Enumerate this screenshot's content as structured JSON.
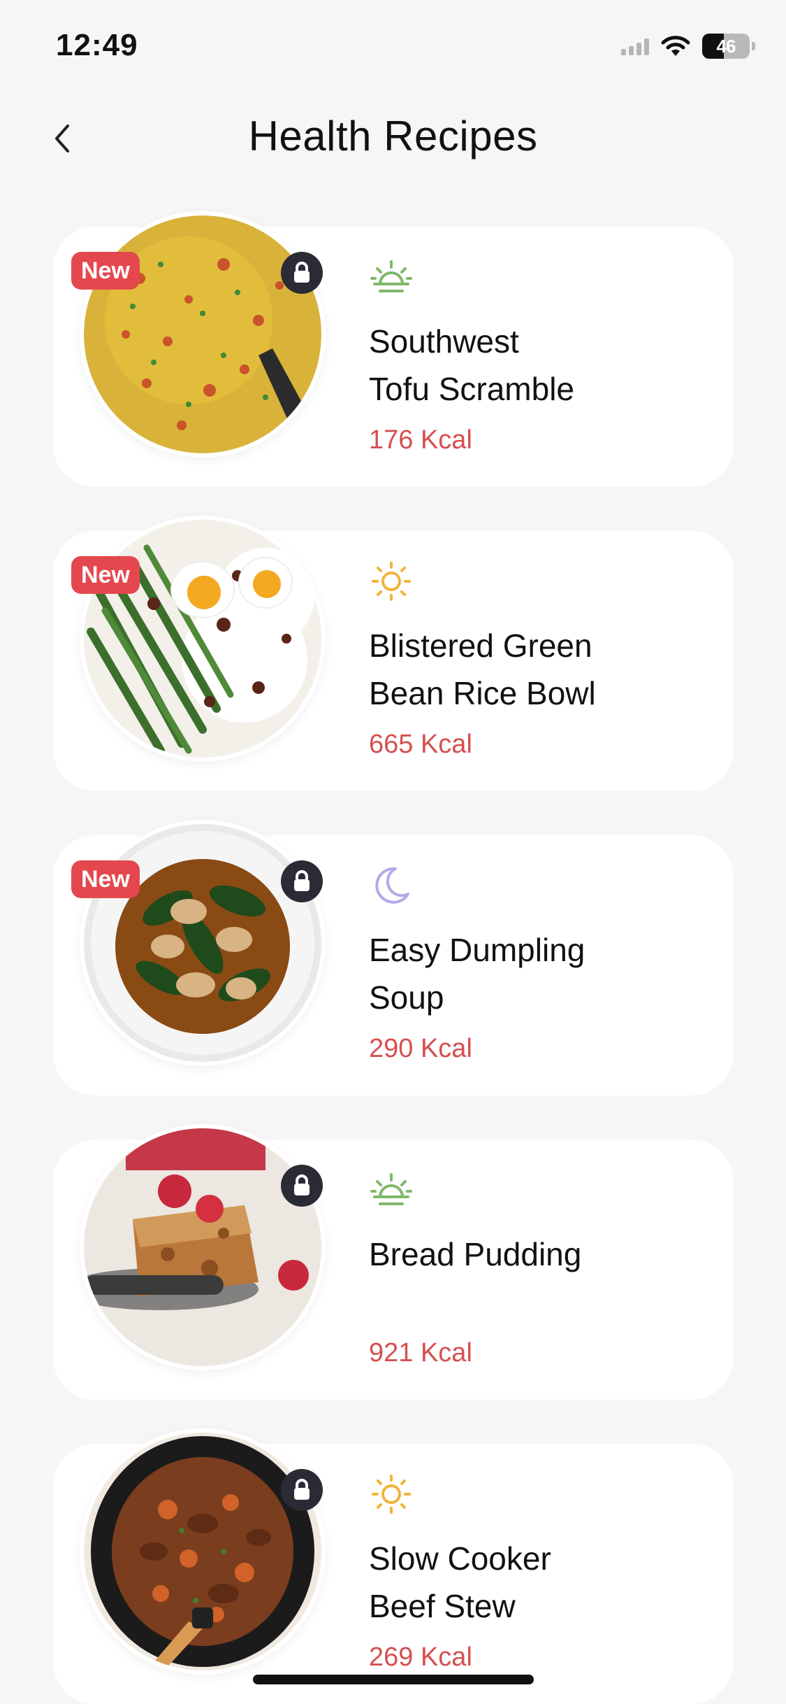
{
  "status_bar": {
    "time": "12:49",
    "battery": "46",
    "battery_fraction": 0.46
  },
  "header": {
    "title": "Health Recipes"
  },
  "recipes": [
    {
      "title": "Southwest\nTofu Scramble",
      "kcal": "176 Kcal",
      "badge": "New",
      "locked": true,
      "meal_icon": "sunrise-icon",
      "color": "#7fb86a"
    },
    {
      "title": "Blistered Green\nBean Rice Bowl",
      "kcal": "665 Kcal",
      "badge": "New",
      "locked": false,
      "meal_icon": "sun-icon",
      "color": "#f0b43c"
    },
    {
      "title": "Easy Dumpling\nSoup",
      "kcal": "290 Kcal",
      "badge": "New",
      "locked": true,
      "meal_icon": "moon-icon",
      "color": "#b6a8ea"
    },
    {
      "title": "Bread Pudding",
      "kcal": "921 Kcal",
      "badge": "",
      "locked": true,
      "meal_icon": "sunrise-icon",
      "color": "#7fb86a"
    },
    {
      "title": "Slow Cooker\nBeef Stew",
      "kcal": "269 Kcal",
      "badge": "",
      "locked": true,
      "meal_icon": "sun-icon",
      "color": "#f0b43c"
    }
  ]
}
